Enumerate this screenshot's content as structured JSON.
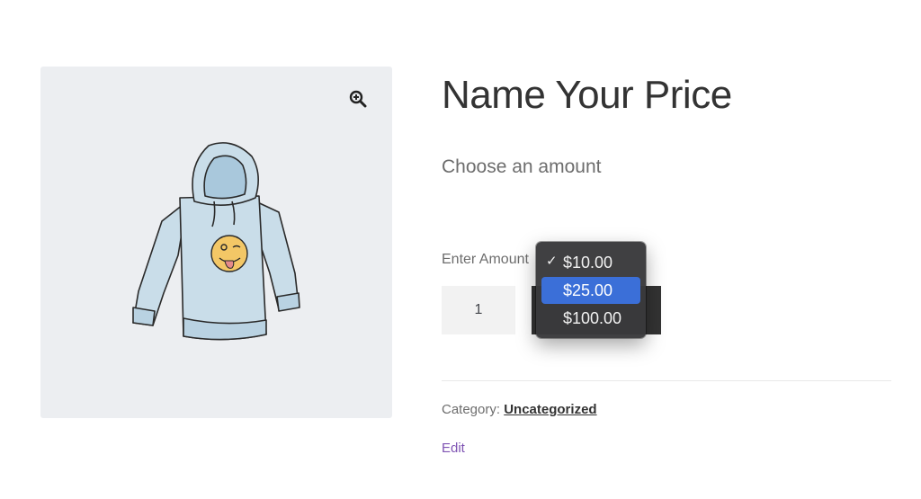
{
  "product": {
    "title": "Name Your Price",
    "price_text": "Choose an amount",
    "amount_label": "Enter Amount",
    "quantity": "1",
    "category_label": "Category:",
    "category_value": "Uncategorized",
    "edit_link": "Edit"
  },
  "gallery": {
    "zoom_icon": "zoom-in-icon",
    "image": "hoodie-with-wink-emoji"
  },
  "amount_dropdown": {
    "options": [
      {
        "label": "$10.00",
        "checked": true
      },
      {
        "label": "$25.00",
        "highlighted": true
      },
      {
        "label": "$100.00"
      }
    ],
    "check_mark": "✓"
  },
  "colors": {
    "accent": "#7f54b3",
    "highlight": "#3b6fd8",
    "dropdown_bg": "#3a3a3c",
    "button_bg": "#333333"
  }
}
